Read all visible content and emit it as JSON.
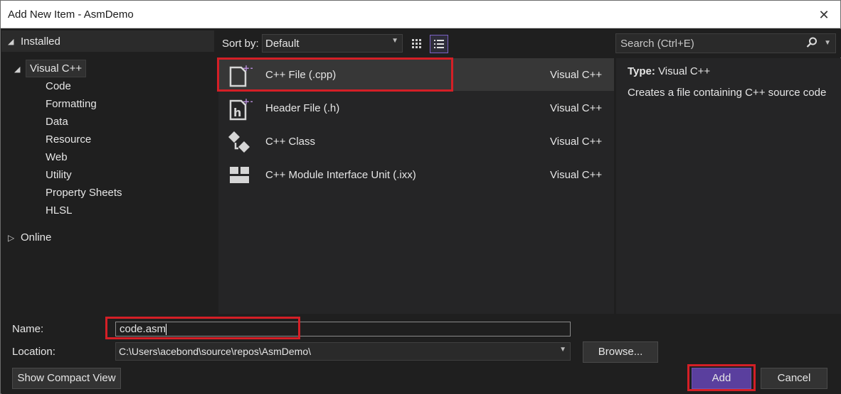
{
  "window": {
    "title": "Add New Item - AsmDemo",
    "close_glyph": "✕"
  },
  "tree": {
    "installed_label": "Installed",
    "visual_cpp_label": "Visual C++",
    "children": [
      "Code",
      "Formatting",
      "Data",
      "Resource",
      "Web",
      "Utility",
      "Property Sheets",
      "HLSL"
    ],
    "online_label": "Online"
  },
  "toolbar": {
    "sort_label": "Sort by:",
    "sort_value": "Default",
    "search_placeholder": "Search (Ctrl+E)"
  },
  "templates": [
    {
      "name": "C++ File (.cpp)",
      "language": "Visual C++",
      "icon": "cpp-file-icon"
    },
    {
      "name": "Header File (.h)",
      "language": "Visual C++",
      "icon": "header-file-icon"
    },
    {
      "name": "C++ Class",
      "language": "Visual C++",
      "icon": "cpp-class-icon"
    },
    {
      "name": "C++ Module Interface Unit (.ixx)",
      "language": "Visual C++",
      "icon": "module-unit-icon"
    }
  ],
  "description": {
    "type_label": "Type:",
    "type_value": "Visual C++",
    "text": "Creates a file containing C++ source code"
  },
  "form": {
    "name_label": "Name:",
    "name_value": "code.asm",
    "location_label": "Location:",
    "location_value": "C:\\Users\\acebond\\source\\repos\\AsmDemo\\",
    "browse_label": "Browse...",
    "compact_view_label": "Show Compact View",
    "add_label": "Add",
    "cancel_label": "Cancel"
  },
  "colors": {
    "accent": "#5a3f9e",
    "highlight": "#d41f26",
    "background": "#1f1f1f"
  }
}
